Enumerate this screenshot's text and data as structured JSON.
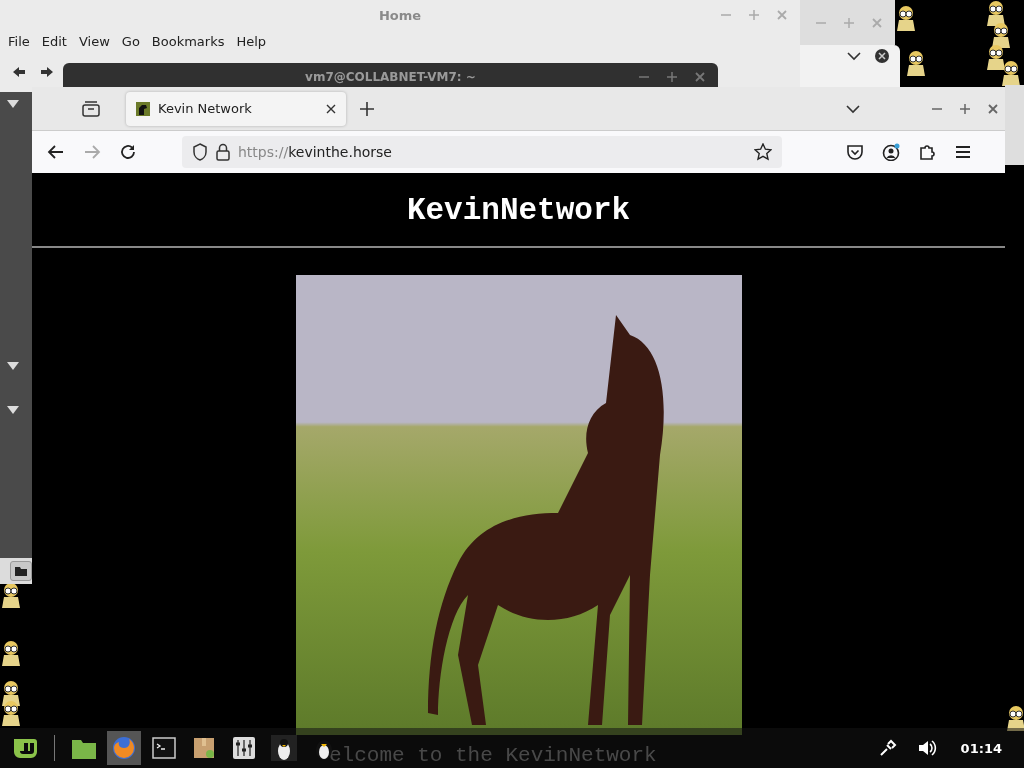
{
  "file_manager": {
    "title": "Home",
    "menu": [
      "File",
      "Edit",
      "View",
      "Go",
      "Bookmarks",
      "Help"
    ]
  },
  "terminal": {
    "title": "vm7@COLLABNET-VM7: ~"
  },
  "browser": {
    "tabs": [
      {
        "label": "Kevin Network",
        "selected": true
      }
    ],
    "nav": {
      "forward_disabled": true
    },
    "url_scheme": "https://",
    "url_host": "kevinthe.horse",
    "page": {
      "heading": "KevinNetwork",
      "welcome": "elcome to the KevinNetwork"
    }
  },
  "taskbar": {
    "clock": "01:14"
  }
}
